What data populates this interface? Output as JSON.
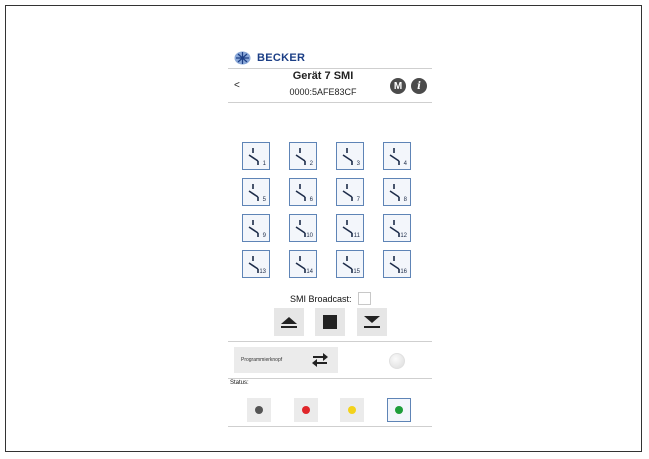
{
  "brand": {
    "name": "BECKER",
    "color": "#1c3f86"
  },
  "header": {
    "title": "Gerät 7 SMI",
    "subtitle": "0000:5AFE83CF",
    "back_label": "<",
    "menu_button_label": "M",
    "info_icon": "info-icon"
  },
  "channels": [
    "1",
    "2",
    "3",
    "4",
    "5",
    "6",
    "7",
    "8",
    "9",
    "10",
    "11",
    "12",
    "13",
    "14",
    "15",
    "16"
  ],
  "broadcast": {
    "label": "SMI Broadcast:",
    "checked": false
  },
  "controls": {
    "up_icon": "up-arrow-icon",
    "stop_icon": "stop-icon",
    "down_icon": "down-arrow-icon"
  },
  "program": {
    "label": "Programmierknopf",
    "icon": "swap-arrows-icon"
  },
  "status": {
    "label": "Status:",
    "items": [
      {
        "color": "#555555"
      },
      {
        "color": "#e0262a"
      },
      {
        "color": "#f3d21b"
      },
      {
        "color": "#1f9e3a",
        "selected": true
      }
    ]
  },
  "colors": {
    "accent": "#5e84b6",
    "button_bg": "#ebebeb"
  }
}
